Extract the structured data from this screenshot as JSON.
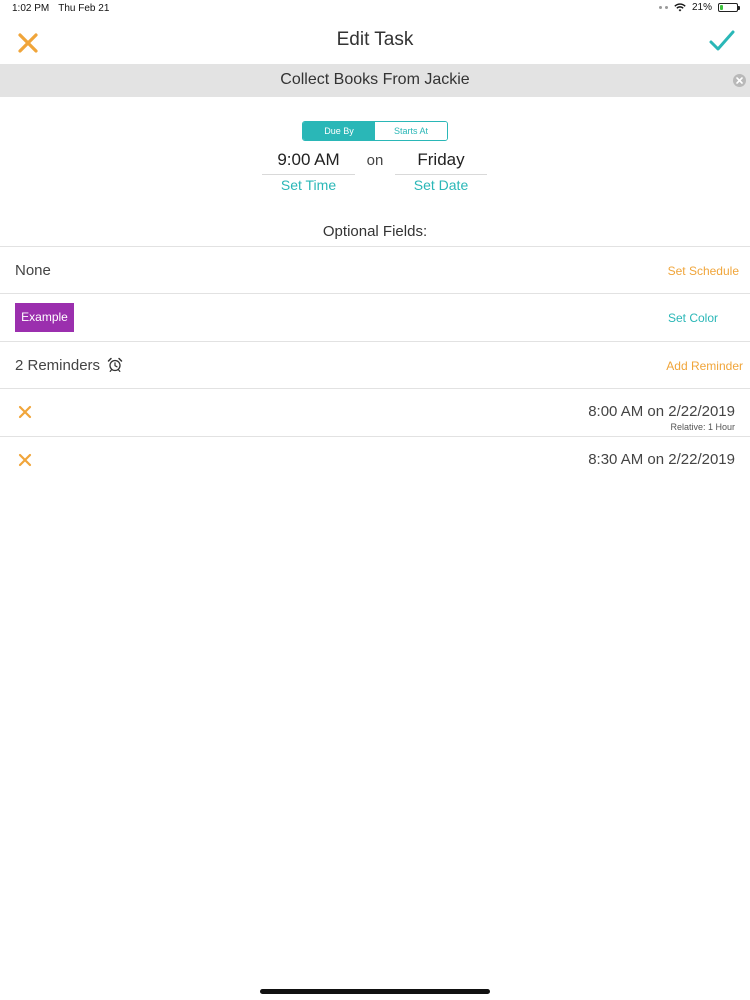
{
  "status_bar": {
    "time": "1:02 PM",
    "date": "Thu Feb 21",
    "battery_percent": "21%",
    "battery_level": 0.21,
    "battery_color": "#3ec33e"
  },
  "nav": {
    "title": "Edit Task",
    "cancel_icon": "close-icon",
    "confirm_icon": "checkmark-icon"
  },
  "task": {
    "name": "Collect Books From Jackie",
    "clear_icon": "clear-circle-icon"
  },
  "schedule_mode": {
    "options": [
      "Due By",
      "Starts At"
    ],
    "selected": "Due By"
  },
  "due": {
    "time": "9:00 AM",
    "connector": "on",
    "day": "Friday",
    "set_time_label": "Set Time",
    "set_date_label": "Set Date"
  },
  "optional_fields": {
    "heading": "Optional Fields:",
    "schedule": {
      "value": "None",
      "action_label": "Set Schedule"
    },
    "color": {
      "swatch_label": "Example",
      "swatch_color": "#9b2fae",
      "action_label": "Set Color"
    },
    "reminders": {
      "summary": "2 Reminders",
      "icon": "alarm-clock-icon",
      "action_label": "Add Reminder",
      "items": [
        {
          "time": "8:00 AM on 2/22/2019",
          "relative": "Relative: 1 Hour"
        },
        {
          "time": "8:30 AM on 2/22/2019",
          "relative": ""
        }
      ]
    }
  },
  "colors": {
    "accent_teal": "#2ab7b7",
    "accent_orange": "#f0a53a",
    "title_bar_bg": "#e3e3e3"
  }
}
